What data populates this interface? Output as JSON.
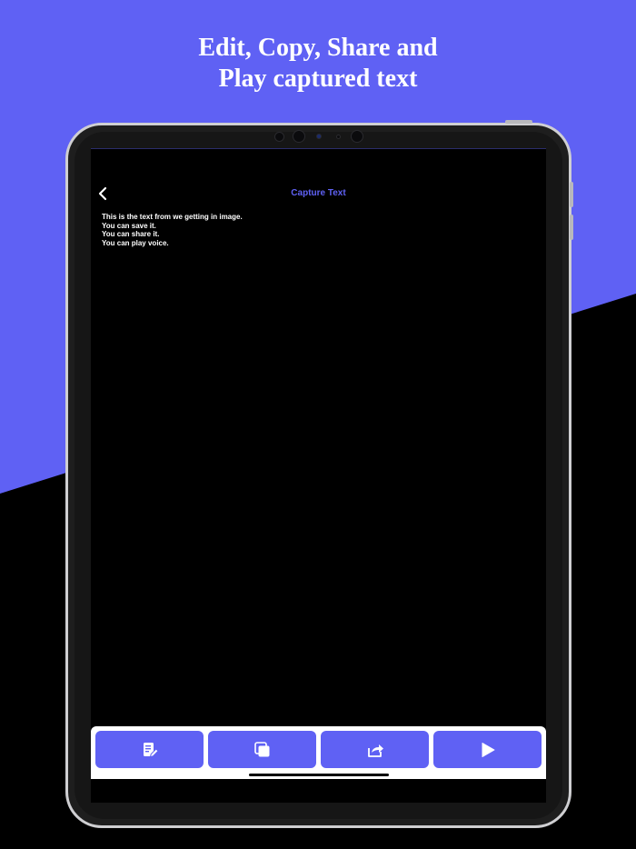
{
  "headline": {
    "line1": "Edit, Copy, Share and",
    "line2": "Play captured text"
  },
  "colors": {
    "accent": "#5f61f4",
    "background_dark": "#000000",
    "text": "#ffffff"
  },
  "screen": {
    "nav": {
      "title": "Capture Text",
      "back_icon": "chevron-left-icon"
    },
    "captured_text": [
      "This is the text from we getting in image.",
      "You can save it.",
      "You can share it.",
      "You can play voice."
    ],
    "toolbar": {
      "buttons": [
        {
          "id": "edit",
          "icon": "edit-document-icon"
        },
        {
          "id": "copy",
          "icon": "copy-icon"
        },
        {
          "id": "share",
          "icon": "share-icon"
        },
        {
          "id": "play",
          "icon": "play-icon"
        }
      ]
    }
  }
}
